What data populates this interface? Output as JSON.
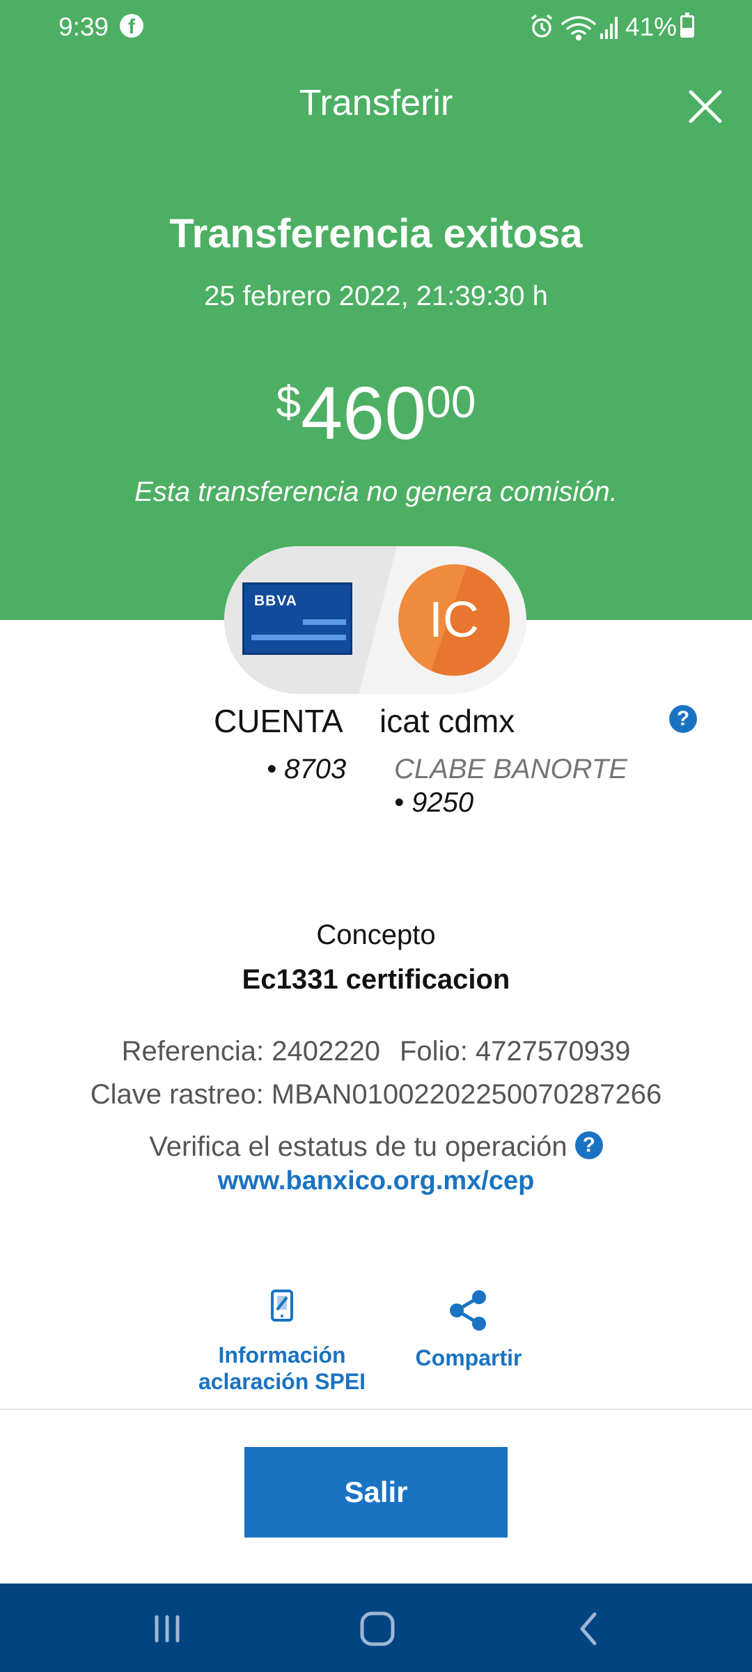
{
  "status_bar": {
    "time": "9:39",
    "app_icon": "facebook-icon",
    "icons": [
      "alarm-icon",
      "wifi-icon",
      "signal-icon"
    ],
    "battery_text": "41%",
    "battery_level": 0.41
  },
  "header": {
    "title": "Transferir",
    "close_icon": "close-icon"
  },
  "result": {
    "title": "Transferencia exitosa",
    "datetime": "25 febrero 2022, 21:39:30 h",
    "amount_currency": "$",
    "amount_integer": "460",
    "amount_decimal": "00",
    "fee_note": "Esta transferencia no genera comisión."
  },
  "origin": {
    "bank_logo": "BBVA",
    "account_label": "CUENTA",
    "account_number": "• 8703"
  },
  "destination": {
    "avatar_initials": "IC",
    "name": "icat cdmx",
    "account_type": "CLABE BANORTE",
    "account_number": "• 9250"
  },
  "concept": {
    "label": "Concepto",
    "value": "Ec1331 certificacion"
  },
  "details": {
    "reference": "Referencia: 2402220",
    "folio": "Folio: 4727570939",
    "tracking_key": "Clave rastreo: MBAN01002202250070287266"
  },
  "verify": {
    "text": "Verifica el estatus de tu operación",
    "link": "www.banxico.org.mx/cep"
  },
  "actions": {
    "spei_line1": "Información",
    "spei_line2": "aclaración SPEI",
    "share": "Compartir"
  },
  "footer": {
    "exit_label": "Salir"
  },
  "colors": {
    "header_green": "#4caf63",
    "primary_blue": "#1a73c2",
    "nav_blue": "#004481",
    "avatar_orange": "#f08a3c"
  },
  "nav": [
    "recent-apps-icon",
    "home-icon",
    "back-icon"
  ]
}
